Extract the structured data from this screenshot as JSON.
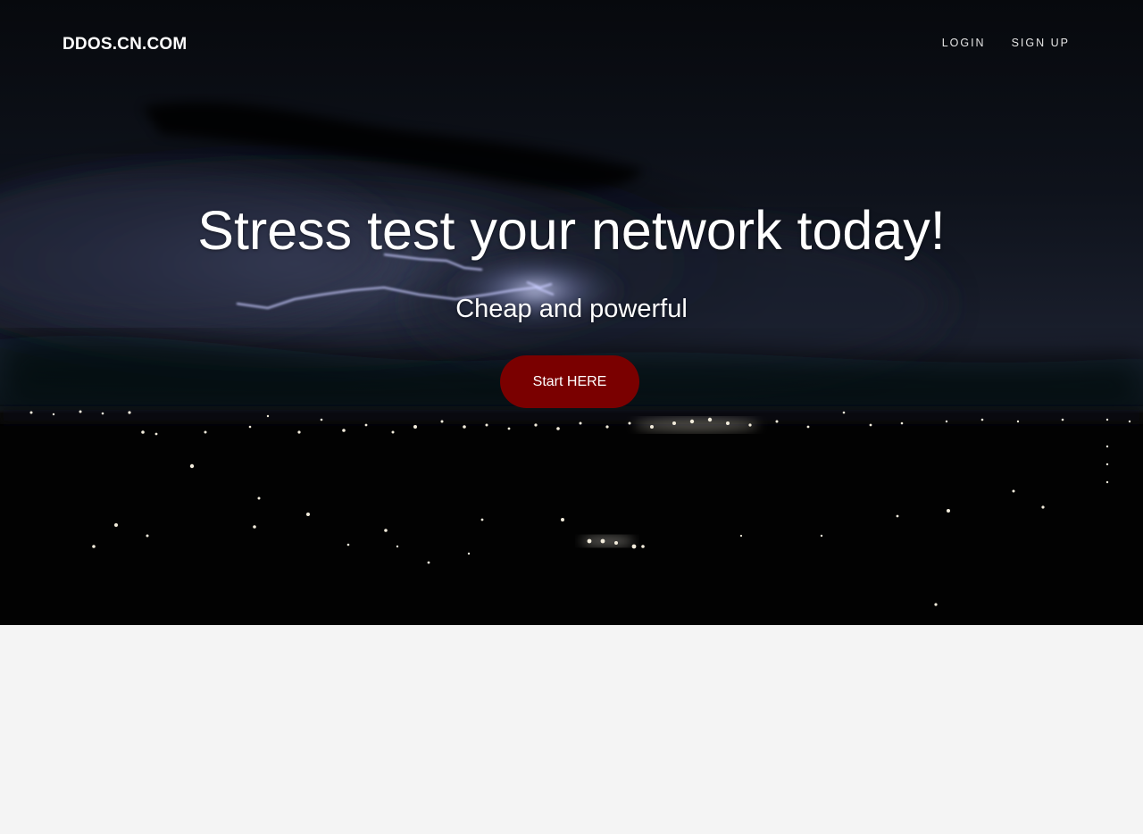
{
  "header": {
    "brand": "DDOS.CN.COM",
    "nav": [
      {
        "label": "LOGIN"
      },
      {
        "label": "SIGN UP"
      }
    ]
  },
  "hero": {
    "headline": "Stress test your network today!",
    "subheadline": "Cheap and powerful",
    "cta_label": "Start HERE"
  },
  "colors": {
    "hero_background": "#020304",
    "cta_background": "#7a0000",
    "text": "#ffffff",
    "page_background": "#f4f4f4"
  }
}
